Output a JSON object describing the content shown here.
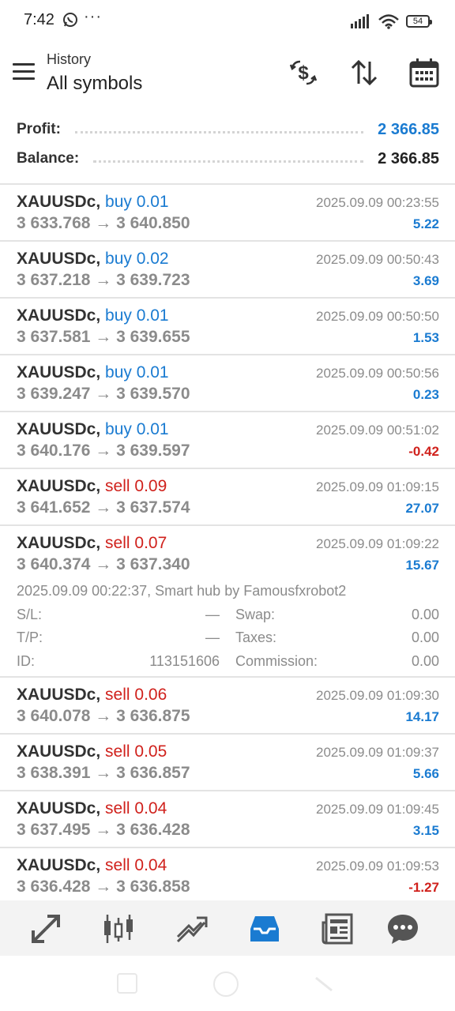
{
  "status": {
    "time": "7:42",
    "battery": "54"
  },
  "header": {
    "subtitle": "History",
    "title": "All symbols"
  },
  "summary": {
    "profit_label": "Profit:",
    "profit_value": "2 366.85",
    "balance_label": "Balance:",
    "balance_value": "2 366.85"
  },
  "trades": [
    {
      "symbol": "XAUUSDc,",
      "side": "buy 0.01",
      "prices": "3 633.768 → 3 640.850",
      "time": "2025.09.09 00:23:55",
      "profit": "5.22"
    },
    {
      "symbol": "XAUUSDc,",
      "side": "buy 0.02",
      "prices": "3 637.218 → 3 639.723",
      "time": "2025.09.09 00:50:43",
      "profit": "3.69"
    },
    {
      "symbol": "XAUUSDc,",
      "side": "buy 0.01",
      "prices": "3 637.581 → 3 639.655",
      "time": "2025.09.09 00:50:50",
      "profit": "1.53"
    },
    {
      "symbol": "XAUUSDc,",
      "side": "buy 0.01",
      "prices": "3 639.247 → 3 639.570",
      "time": "2025.09.09 00:50:56",
      "profit": "0.23"
    },
    {
      "symbol": "XAUUSDc,",
      "side": "buy 0.01",
      "prices": "3 640.176 → 3 639.597",
      "time": "2025.09.09 00:51:02",
      "profit": "-0.42"
    },
    {
      "symbol": "XAUUSDc,",
      "side": "sell 0.09",
      "prices": "3 641.652 → 3 637.574",
      "time": "2025.09.09 01:09:15",
      "profit": "27.07"
    },
    {
      "symbol": "XAUUSDc,",
      "side": "sell 0.07",
      "prices": "3 640.374 → 3 637.340",
      "time": "2025.09.09 01:09:22",
      "profit": "15.67"
    },
    {
      "symbol": "XAUUSDc,",
      "side": "sell 0.06",
      "prices": "3 640.078 → 3 636.875",
      "time": "2025.09.09 01:09:30",
      "profit": "14.17"
    },
    {
      "symbol": "XAUUSDc,",
      "side": "sell 0.05",
      "prices": "3 638.391 → 3 636.857",
      "time": "2025.09.09 01:09:37",
      "profit": "5.66"
    },
    {
      "symbol": "XAUUSDc,",
      "side": "sell 0.04",
      "prices": "3 637.495 → 3 636.428",
      "time": "2025.09.09 01:09:45",
      "profit": "3.15"
    },
    {
      "symbol": "XAUUSDc,",
      "side": "sell 0.04",
      "prices": "3 636.428 → 3 636.858",
      "time": "2025.09.09 01:09:53",
      "profit": "-1.27"
    }
  ],
  "details": {
    "comment": "2025.09.09 00:22:37, Smart hub by Famousfxrobot2",
    "sl_label": "S/L:",
    "sl_value": "—",
    "swap_label": "Swap:",
    "swap_value": "0.00",
    "tp_label": "T/P:",
    "tp_value": "—",
    "taxes_label": "Taxes:",
    "taxes_value": "0.00",
    "id_label": "ID:",
    "id_value": "113151606",
    "commission_label": "Commission:",
    "commission_value": "0.00"
  },
  "icons": {
    "header": [
      "currency-exchange-icon",
      "sort-icon",
      "calendar-icon"
    ],
    "nav": [
      "quotes-icon",
      "chart-icon",
      "trade-icon",
      "history-icon",
      "news-icon",
      "messages-icon"
    ]
  },
  "colors": {
    "buy": "#1a7bd1",
    "sell": "#d0211c",
    "active_nav": "#1a7bd1"
  }
}
